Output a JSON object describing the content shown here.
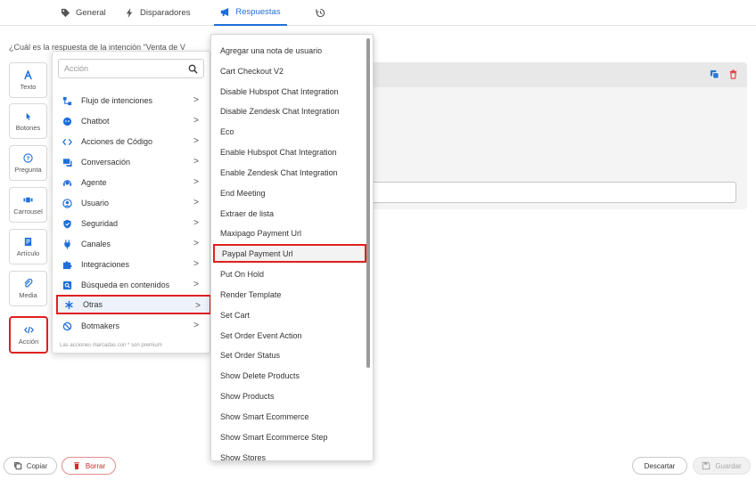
{
  "tabs": [
    {
      "label": "General",
      "icon": "tag-icon"
    },
    {
      "label": "Disparadores",
      "icon": "bolt-icon"
    },
    {
      "label": "Respuestas",
      "icon": "megaphone-icon",
      "active": true
    },
    {
      "label": "",
      "icon": "history-icon"
    }
  ],
  "question_text": "¿Cuál es la respuesta de la intención \"Venta de V",
  "tools": [
    {
      "label": "Texto",
      "icon": "text-icon"
    },
    {
      "label": "Botones",
      "icon": "pointer-icon"
    },
    {
      "label": "Pregunta",
      "icon": "question-icon"
    },
    {
      "label": "Carrousel",
      "icon": "carousel-icon"
    },
    {
      "label": "Artículo",
      "icon": "article-icon"
    },
    {
      "label": "Media",
      "icon": "media-icon"
    },
    {
      "label": "Acción",
      "icon": "code-icon",
      "highlighted": true
    }
  ],
  "action_menu": {
    "search_placeholder": "Acción",
    "categories": [
      {
        "label": "Flujo de intenciones",
        "icon": "flow-icon"
      },
      {
        "label": "Chatbot",
        "icon": "chatbot-icon"
      },
      {
        "label": "Acciones de Código",
        "icon": "code-brackets-icon"
      },
      {
        "label": "Conversación",
        "icon": "conversation-icon"
      },
      {
        "label": "Agente",
        "icon": "agent-icon"
      },
      {
        "label": "Usuario",
        "icon": "user-icon"
      },
      {
        "label": "Seguridad",
        "icon": "shield-icon"
      },
      {
        "label": "Canales",
        "icon": "plug-icon"
      },
      {
        "label": "Integraciones",
        "icon": "puzzle-icon"
      },
      {
        "label": "Búsqueda en contenidos",
        "icon": "search-content-icon"
      },
      {
        "label": "Otras",
        "icon": "asterisk-icon",
        "highlighted": true
      },
      {
        "label": "Botmakers",
        "icon": "botmakers-icon"
      }
    ],
    "note": "Las acciones marcadas con * son premium"
  },
  "submenu_items": [
    "Agregar una nota de usuario",
    "Cart Checkout V2",
    "Disable Hubspot Chat Integration",
    "Disable Zendesk Chat Integration",
    "Eco",
    "Enable Hubspot Chat Integration",
    "Enable Zendesk Chat Integration",
    "End Meeting",
    "Extraer de lista",
    "Maxipago Payment Url",
    "Paypal Payment Url",
    "Put On Hold",
    "Render Template",
    "Set Cart",
    "Set Order Event Action",
    "Set Order Status",
    "Show Delete Products",
    "Show Products",
    "Show Smart Ecommerce",
    "Show Smart Ecommerce Step",
    "Show Stores"
  ],
  "submenu_highlighted": "Paypal Payment Url",
  "footer": {
    "copy": "Copiar",
    "delete": "Borrar",
    "discard": "Descartar",
    "save": "Guardar"
  },
  "colors": {
    "accent": "#1e6fd9",
    "highlight": "#e02020",
    "delete": "#d12a2a"
  }
}
